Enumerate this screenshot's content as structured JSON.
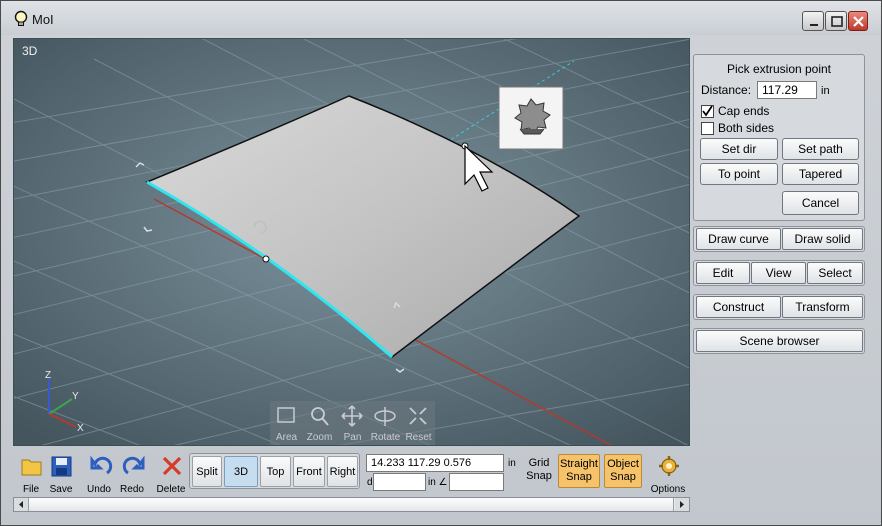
{
  "window": {
    "title": "MoI"
  },
  "viewport": {
    "label": "3D",
    "nav": [
      {
        "name": "area",
        "label": "Area"
      },
      {
        "name": "zoom",
        "label": "Zoom"
      },
      {
        "name": "pan",
        "label": "Pan"
      },
      {
        "name": "rotate",
        "label": "Rotate"
      },
      {
        "name": "reset",
        "label": "Reset"
      }
    ],
    "axes": {
      "x": "X",
      "y": "Y",
      "z": "Z"
    }
  },
  "command_panel": {
    "title": "Pick extrusion point",
    "distance_label": "Distance:",
    "distance_value": "117.29",
    "distance_unit": "in",
    "cap_ends_label": "Cap ends",
    "cap_ends_checked": true,
    "both_sides_label": "Both sides",
    "both_sides_checked": false,
    "buttons": {
      "set_dir": "Set dir",
      "set_path": "Set path",
      "to_point": "To point",
      "tapered": "Tapered",
      "cancel": "Cancel"
    }
  },
  "palette": {
    "draw_curve": "Draw curve",
    "draw_solid": "Draw solid",
    "edit": "Edit",
    "view": "View",
    "select": "Select",
    "construct": "Construct",
    "transform": "Transform",
    "scene_browser": "Scene browser"
  },
  "toolbar": {
    "file": "File",
    "save": "Save",
    "undo": "Undo",
    "redo": "Redo",
    "delete": "Delete",
    "views": {
      "split": "Split",
      "3d": "3D",
      "top": "Top",
      "front": "Front",
      "right": "Right",
      "active": "3D"
    },
    "coords": "14.233     117.29  0.576",
    "coord_unit": "in",
    "distance_prefix": "d",
    "angle_unit": "in ∠",
    "grid_snap": [
      "Grid",
      "Snap"
    ],
    "straight_snap": [
      "Straight",
      "Snap"
    ],
    "object_snap": [
      "Object",
      "Snap"
    ],
    "options": "Options"
  },
  "colors": {
    "viewport_bg": "#4f6470",
    "edge_highlight": "#2ee6f0",
    "snap_on": "#f6c36a",
    "x_axis": "#c0392b"
  }
}
